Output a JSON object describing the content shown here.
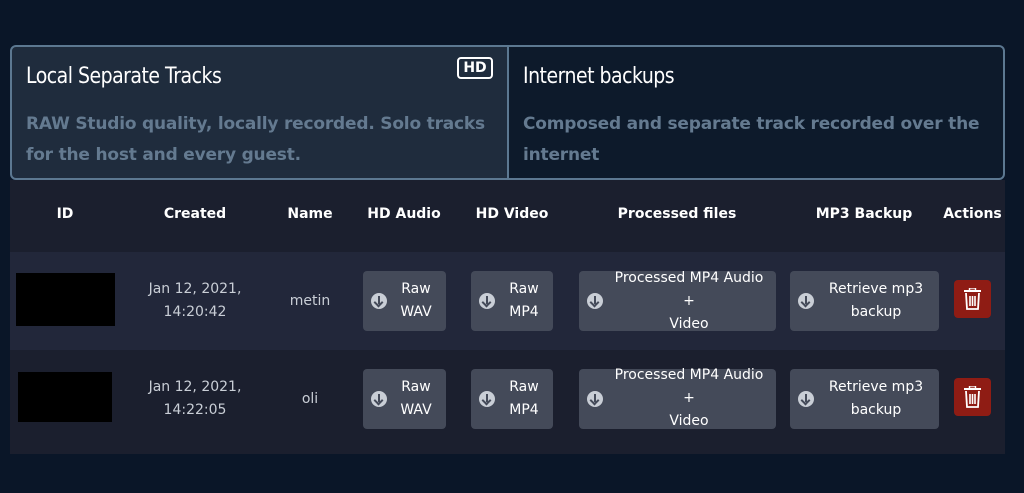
{
  "tabs": {
    "local": {
      "title": "Local Separate Tracks",
      "badge": "HD",
      "description": "RAW Studio quality, locally recorded. Solo tracks for the host and every guest."
    },
    "internet": {
      "title": "Internet backups",
      "description": "Composed and separate track recorded over the internet"
    }
  },
  "table": {
    "headers": [
      "ID",
      "Created",
      "Name",
      "HD Audio",
      "HD Video",
      "Processed files",
      "MP3 Backup",
      "Actions"
    ],
    "rows": [
      {
        "created": "Jan 12, 2021,\n14:20:42",
        "name": "metin",
        "hd_audio": "Raw\nWAV",
        "hd_video": "Raw\nMP4",
        "processed": "Processed MP4 Audio +\nVideo",
        "mp3": "Retrieve mp3\nbackup"
      },
      {
        "created": "Jan 12, 2021,\n14:22:05",
        "name": "oli",
        "hd_audio": "Raw\nWAV",
        "hd_video": "Raw\nMP4",
        "processed": "Processed MP4 Audio +\nVideo",
        "mp3": "Retrieve mp3\nbackup"
      }
    ]
  },
  "icons": {
    "download": "download-circle-icon",
    "delete": "trash-icon"
  },
  "colors": {
    "background": "#0a1628",
    "active_tab": "#1f2c3d",
    "tab_border": "#5c7891",
    "table_bg": "#1b1f2e",
    "button": "#444a59",
    "delete": "#8f1c14"
  }
}
